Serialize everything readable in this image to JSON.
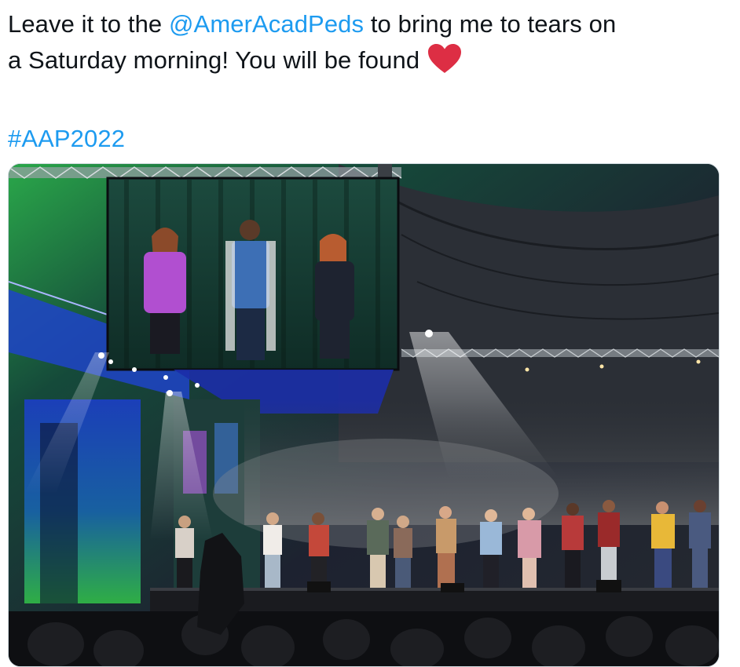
{
  "tweet": {
    "text_line1_prefix": "Leave it to the ",
    "mention": "@AmerAcadPeds",
    "text_line1_suffix": " to bring me to tears on",
    "text_line2": "a Saturday morning! You will be found",
    "heart_emoji_icon": "red-heart-icon",
    "hashtag": "#AAP2022"
  },
  "colors": {
    "link": "#1d9bf0",
    "text": "#0f1419",
    "heart": "#dd2e44",
    "card_border": "#cfd9de"
  },
  "media": {
    "type": "photo"
  }
}
